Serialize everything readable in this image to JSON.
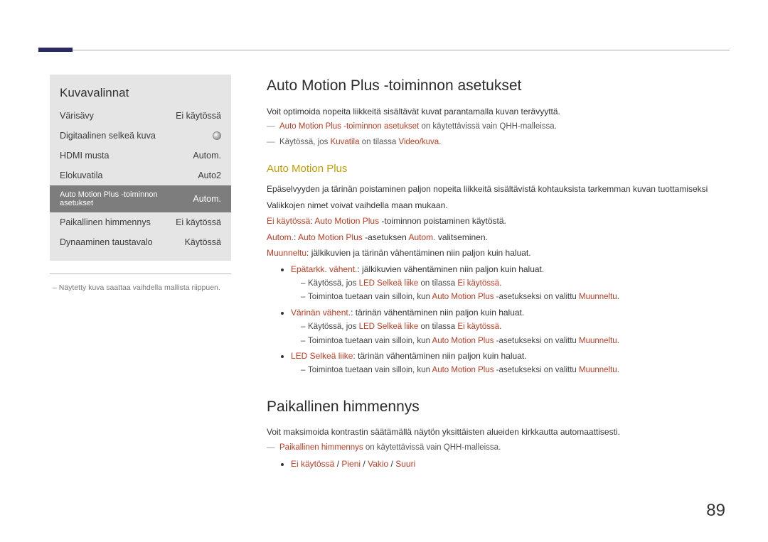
{
  "page_number": "89",
  "menu": {
    "title": "Kuvavalinnat",
    "rows": [
      {
        "label": "Värisävy",
        "value": "Ei käytössä"
      },
      {
        "label": "Digitaalinen selkeä kuva",
        "value": ""
      },
      {
        "label": "HDMI musta",
        "value": "Autom."
      },
      {
        "label": "Elokuvatila",
        "value": "Auto2"
      },
      {
        "label": "Auto Motion Plus -toiminnon asetukset",
        "value": "Autom."
      },
      {
        "label": "Paikallinen himmennys",
        "value": "Ei käytössä"
      },
      {
        "label": "Dynaaminen taustavalo",
        "value": "Käytössä"
      }
    ],
    "note": "– Näytetty kuva saattaa vaihdella mallista riippuen."
  },
  "s1": {
    "title": "Auto Motion Plus -toiminnon asetukset",
    "intro": "Voit optimoida nopeita liikkeitä sisältävät kuvat parantamalla kuvan terävyyttä.",
    "note1_a": "Auto Motion Plus -toiminnon asetukset",
    "note1_b": " on käytettävissä vain QHH-malleissa.",
    "note2_a": "Käytössä, jos ",
    "note2_b": "Kuvatila",
    "note2_c": " on tilassa ",
    "note2_d": "Video/kuva",
    "sub_title": "Auto Motion Plus",
    "p1": "Epäselvyyden ja tärinän poistaminen paljon nopeita liikkeitä sisältävistä kohtauksista tarkemman kuvan tuottamiseksi",
    "p2": "Valikkojen nimet voivat vaihdella maan mukaan.",
    "l1_a": "Ei käytössä",
    "l1_b": ": ",
    "l1_c": "Auto Motion Plus",
    "l1_d": " -toiminnon poistaminen käytöstä.",
    "l2_a": "Autom.",
    "l2_b": ": ",
    "l2_c": "Auto Motion Plus",
    "l2_d": " -asetuksen ",
    "l2_e": "Autom.",
    "l2_f": " valitseminen.",
    "l3_a": "Muunneltu",
    "l3_b": ": jälkikuvien ja tärinän vähentäminen niin paljon kuin haluat.",
    "b1_a": "Epätarkk. vähent.",
    "b1_b": ": jälkikuvien vähentäminen niin paljon kuin haluat.",
    "b1s1_a": "Käytössä, jos ",
    "b1s1_b": "LED Selkeä liike",
    "b1s1_c": " on tilassa ",
    "b1s1_d": "Ei käytössä",
    "b1s2_a": "Toimintoa tuetaan vain silloin, kun ",
    "b1s2_b": "Auto Motion Plus",
    "b1s2_c": " -asetukseksi on valittu ",
    "b1s2_d": "Muunneltu",
    "b2_a": "Värinän vähent.",
    "b2_b": ": tärinän vähentäminen niin paljon kuin haluat.",
    "b3_a": "LED Selkeä liike",
    "b3_b": ": tärinän vähentäminen niin paljon kuin haluat."
  },
  "s2": {
    "title": "Paikallinen himmennys",
    "intro": "Voit maksimoida kontrastin säätämällä näytön yksittäisten alueiden kirkkautta automaattisesti.",
    "note_a": "Paikallinen himmennys",
    "note_b": " on käytettävissä vain QHH-malleissa.",
    "opts_a": "Ei käytössä",
    "opts_b": "Pieni",
    "opts_c": "Vakio",
    "opts_d": "Suuri"
  }
}
